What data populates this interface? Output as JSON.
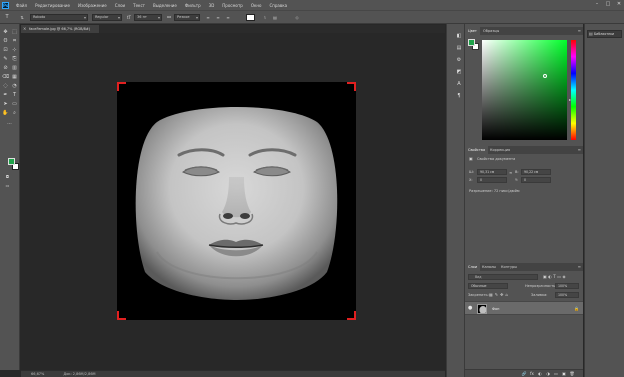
{
  "app": {
    "logo": "Ps"
  },
  "menu": [
    "Файл",
    "Редактирование",
    "Изображение",
    "Слои",
    "Текст",
    "Выделение",
    "Фильтр",
    "3D",
    "Просмотр",
    "Окно",
    "Справка"
  ],
  "window_controls": [
    "–",
    "□",
    "✕"
  ],
  "options": {
    "tool_icon": "T",
    "font_family": "Roboto",
    "font_style": "Regular",
    "font_size": "36 пт",
    "aa_label": "aa",
    "aa_mode": "Резкое",
    "text_color": "#ffffff"
  },
  "document": {
    "tab_title": "faceFemale.jpg @ 66,7% (RGB/8#)",
    "close": "×",
    "zoom": "66,67%",
    "doc_info": "Док: 2,86M/2,86M"
  },
  "colors": {
    "foreground": "#1fa34a",
    "background": "#ffffff",
    "crop_accent": "#e12020"
  },
  "color_panel": {
    "tabs": [
      "Цвет",
      "Образцы"
    ],
    "menu": "≡"
  },
  "properties_panel": {
    "tabs": [
      "Свойства",
      "Коррекция"
    ],
    "title": "Свойства документа",
    "w_label": "Ш:",
    "w_value": "90,31 см",
    "h_label": "В:",
    "h_value": "90,22 см",
    "x_label": "X:",
    "x_value": "0",
    "y_label": "Y:",
    "y_value": "0",
    "resolution": "Разрешение: 72 пикс/дюйм"
  },
  "layers_panel": {
    "tabs": [
      "Слои",
      "Каналы",
      "Контуры"
    ],
    "search_placeholder": "Вид",
    "blend_mode": "Обычные",
    "opacity_label": "Непрозрачность:",
    "opacity_value": "100%",
    "lock_label": "Закрепить:",
    "fill_label": "Заливка:",
    "fill_value": "100%",
    "layer_name": "Фон",
    "eye": "●",
    "lock_icon": "🔒",
    "footer_icons": [
      "🔗",
      "fx",
      "◐",
      "◑",
      "▭",
      "▣",
      "🗑"
    ]
  },
  "library": {
    "button": "Библиотеки",
    "icon": "▤"
  },
  "tools": [
    "✥",
    "⬚",
    "ʘ",
    "⌗",
    "⊡",
    "⊹",
    "✎",
    "⎘",
    "⊘",
    "▥",
    "◌",
    "✒",
    "T",
    "➤",
    "▭",
    "✋",
    "⌕",
    "···"
  ],
  "dock_icons": [
    "◧",
    "▤",
    "⚙",
    "◩",
    "A",
    "¶"
  ]
}
